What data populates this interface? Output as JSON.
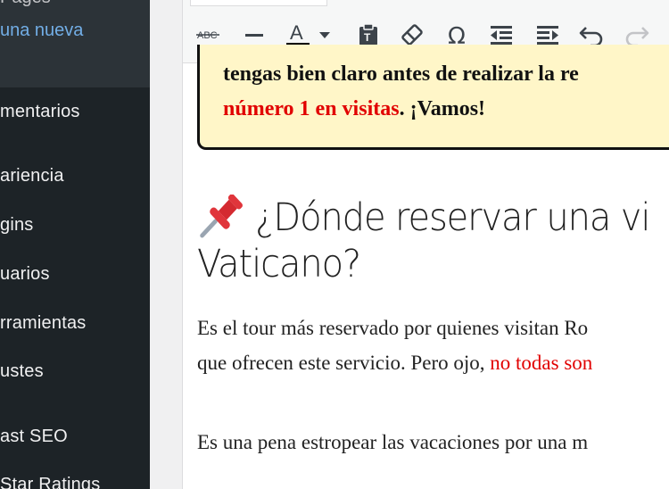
{
  "sidebar": {
    "submenu_prev": "Pages",
    "submenu_link": "una nueva",
    "items": [
      {
        "label": "mentarios"
      },
      {
        "label": "ariencia"
      },
      {
        "label": "gins"
      },
      {
        "label": "uarios"
      },
      {
        "label": "rramientas"
      },
      {
        "label": "ustes"
      },
      {
        "label": "ast SEO"
      },
      {
        "label": "Star Ratings"
      }
    ]
  },
  "toolbar": {
    "buttons": [
      {
        "icon": "strikethrough-icon"
      },
      {
        "icon": "horizontal-line-icon"
      },
      {
        "icon": "text-color-icon"
      },
      {
        "icon": "chevron-down-icon"
      },
      {
        "icon": "paste-as-text-icon"
      },
      {
        "icon": "clear-formatting-icon"
      },
      {
        "icon": "special-character-icon"
      },
      {
        "icon": "outdent-icon"
      },
      {
        "icon": "indent-icon"
      },
      {
        "icon": "undo-icon"
      },
      {
        "icon": "redo-icon"
      }
    ],
    "strike_glyph": "ABC",
    "color_glyph": "A",
    "omega_glyph": "Ω",
    "text_color_swatch": "#000000"
  },
  "content": {
    "callout": {
      "line1": "tengas bien claro antes de realizar la re",
      "line2_red": "número 1 en visitas",
      "line2_rest": ". ¡Vamos!",
      "background": "#fff6c8",
      "highlight_color": "#e10000"
    },
    "heading": {
      "emoji_icon": "pushpin-icon",
      "line1": "¿Dónde reservar una vi",
      "line2": "Vaticano?"
    },
    "paragraphs": [
      {
        "line1": "Es el tour más reservado por quienes visitan Ro",
        "line2": "que ofrecen este servicio. Pero ojo, ",
        "line2_red": "no todas son"
      },
      {
        "line1": "Es una pena estropear las vacaciones por una m"
      }
    ]
  }
}
